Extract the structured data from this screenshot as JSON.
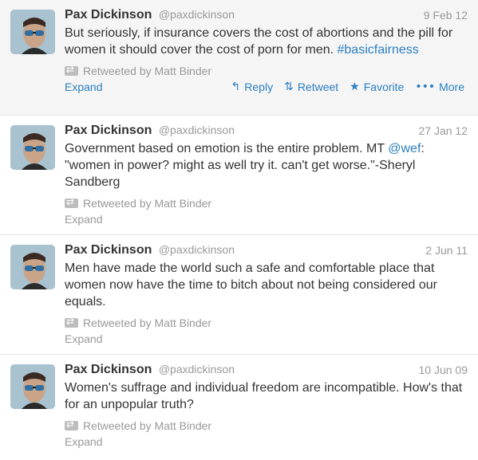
{
  "tweets": [
    {
      "fullname": "Pax Dickinson",
      "username": "@paxdickinson",
      "time": "9 Feb 12",
      "text_before_link": "But seriously, if insurance covers the cost of abortions and the pill for women it should cover the cost of porn for men. ",
      "link": "#basicfairness",
      "text_after_link": "",
      "retweeted_by": "Retweeted by Matt Binder",
      "expand": "Expand",
      "actions": {
        "reply": "Reply",
        "retweet": "Retweet",
        "favorite": "Favorite",
        "more": "More"
      }
    },
    {
      "fullname": "Pax Dickinson",
      "username": "@paxdickinson",
      "time": "27 Jan 12",
      "text_before_link": "Government based on emotion is the entire problem. MT ",
      "link": "@wef",
      "text_after_link": ": \"women in power? might as well try it. can't get worse.\"-Sheryl Sandberg",
      "retweeted_by": "Retweeted by Matt Binder",
      "expand": "Expand"
    },
    {
      "fullname": "Pax Dickinson",
      "username": "@paxdickinson",
      "time": "2 Jun 11",
      "text": "Men have made the world such a safe and comfortable place that women now have the time to bitch about not being considered our equals.",
      "retweeted_by": "Retweeted by Matt Binder",
      "expand": "Expand"
    },
    {
      "fullname": "Pax Dickinson",
      "username": "@paxdickinson",
      "time": "10 Jun 09",
      "text": "Women's suffrage and individual freedom are incompatible. How's that for an unpopular truth?",
      "retweeted_by": "Retweeted by Matt Binder",
      "expand": "Expand"
    }
  ],
  "icons": {
    "reply": "reply-arrow-icon",
    "retweet": "retweet-icon",
    "favorite": "star-icon",
    "more": "more-dots-icon",
    "retweeted": "retweet-small-icon"
  },
  "colors": {
    "link": "#2a7fc1",
    "muted": "#999999",
    "text": "#333333",
    "hover_bg": "#f5f5f5"
  }
}
